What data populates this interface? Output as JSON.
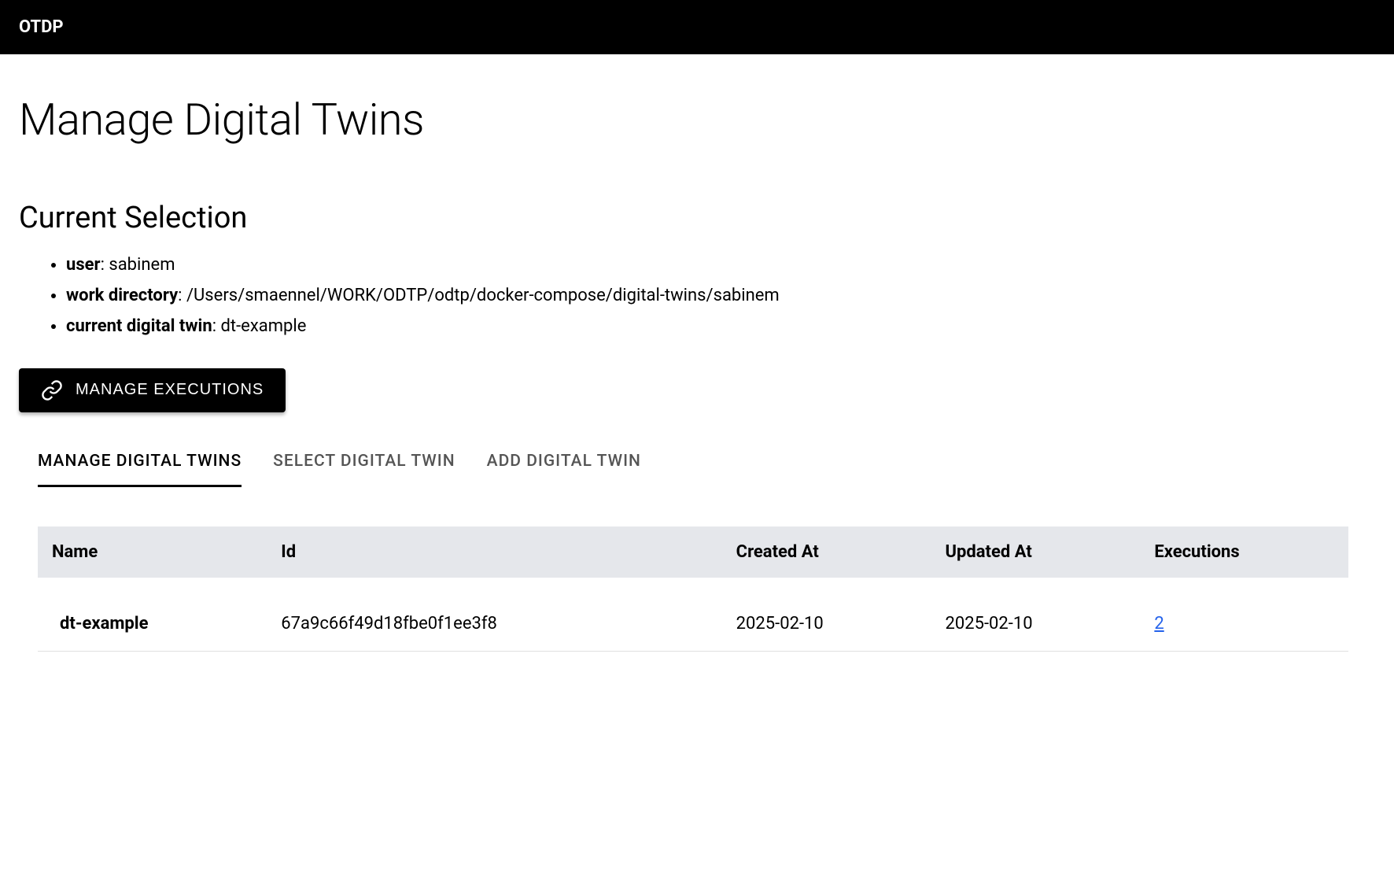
{
  "header": {
    "app_name": "OTDP"
  },
  "page": {
    "title": "Manage Digital Twins",
    "section_title": "Current Selection",
    "selection": {
      "user_label": "user",
      "user_value": "sabinem",
      "workdir_label": "work directory",
      "workdir_value": "/Users/smaennel/WORK/ODTP/odtp/docker-compose/digital-twins/sabinem",
      "current_twin_label": "current digital twin",
      "current_twin_value": "dt-example"
    },
    "manage_executions_button": "MANAGE EXECUTIONS"
  },
  "tabs": {
    "manage": "MANAGE DIGITAL TWINS",
    "select": "SELECT DIGITAL TWIN",
    "add": "ADD DIGITAL TWIN",
    "active": "manage"
  },
  "table": {
    "headers": {
      "name": "Name",
      "id": "Id",
      "created_at": "Created At",
      "updated_at": "Updated At",
      "executions": "Executions"
    },
    "rows": [
      {
        "name": "dt-example",
        "id": "67a9c66f49d18fbe0f1ee3f8",
        "created_at": "2025-02-10",
        "updated_at": "2025-02-10",
        "executions": "2"
      }
    ]
  }
}
